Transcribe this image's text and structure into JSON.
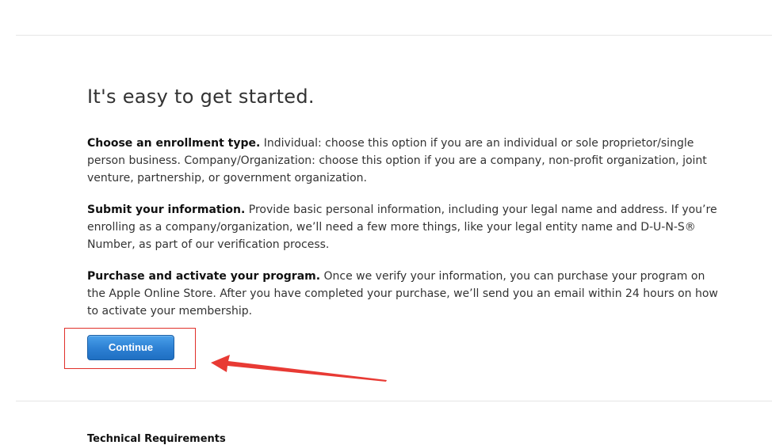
{
  "page": {
    "heading": "It's easy to get started."
  },
  "steps": [
    {
      "title": "Choose an enrollment type.",
      "text": " Individual: choose this option if you are an individual or sole proprietor/single person business. Company/Organization: choose this option if you are a company, non-profit organization, joint venture, partnership, or government organization."
    },
    {
      "title": "Submit your information.",
      "text": " Provide basic personal information, including your legal name and address. If you’re enrolling as a company/organization, we’ll need a few more things, like your legal entity name and D-U-N-S® Number, as part of our verification process."
    },
    {
      "title": "Purchase and activate your program.",
      "text": " Once we verify your information, you can purchase your program on the Apple Online Store. After you have completed your purchase, we’ll send you an email within 24 hours on how to activate your membership."
    }
  ],
  "actions": {
    "continue_label": "Continue"
  },
  "footer": {
    "technical_requirements": "Technical Requirements"
  },
  "annotation": {
    "highlight_color": "#e0302a",
    "arrow_icon": "arrow-left-icon"
  },
  "colors": {
    "button_blue": "#2c7fd2",
    "text": "#333333"
  }
}
